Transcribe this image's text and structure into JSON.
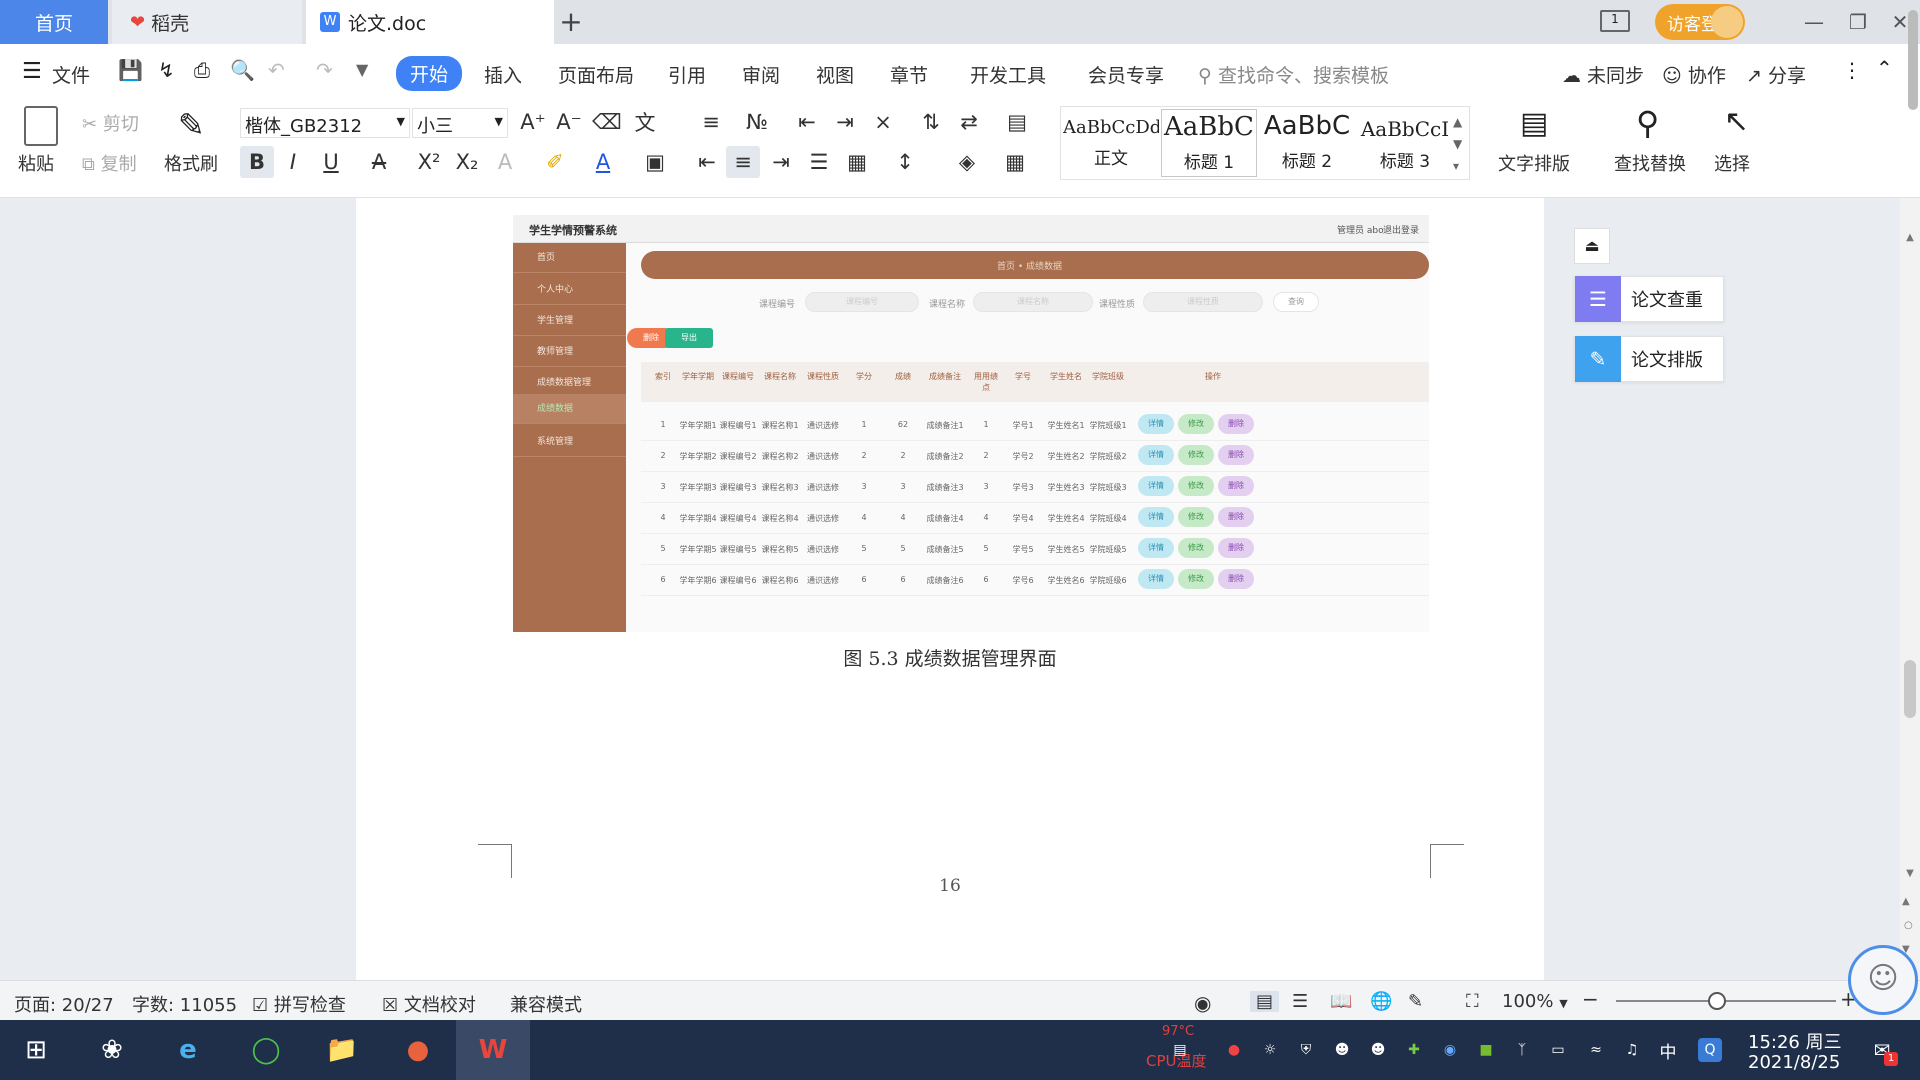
{
  "tabs": {
    "home": "首页",
    "daoke": "稻壳",
    "doc": "论文.doc",
    "new_tab": "+"
  },
  "title_bar": {
    "login": "访客登录"
  },
  "menu": {
    "file": "文件",
    "items": [
      "开始",
      "插入",
      "页面布局",
      "引用",
      "审阅",
      "视图",
      "章节",
      "开发工具",
      "会员专享"
    ],
    "search_placeholder": "查找命令、搜索模板",
    "sync": "未同步",
    "collab": "协作",
    "share": "分享"
  },
  "ribbon": {
    "paste": "粘贴",
    "cut": "剪切",
    "copy": "复制",
    "format_painter": "格式刷",
    "font_name": "楷体_GB2312",
    "font_size": "小三",
    "styles": [
      {
        "preview": "AaBbCcDd",
        "name": "正文"
      },
      {
        "preview": "AaBbC",
        "name": "标题 1"
      },
      {
        "preview": "AaBbC",
        "name": "标题 2"
      },
      {
        "preview": "AaBbCcI",
        "name": "标题 3"
      }
    ],
    "text_layout": "文字排版",
    "find_replace": "查找替换",
    "select": "选择"
  },
  "document": {
    "caption": "图 5.3  成绩数据管理界面",
    "page_number": "16",
    "screenshot": {
      "app_title": "学生学情预警系统",
      "user": "管理员 abo",
      "logout": "退出登录",
      "menu": [
        "首页",
        "个人中心",
        "学生管理",
        "教师管理",
        "成绩数据管理",
        "成绩数据",
        "系统管理"
      ],
      "breadcrumb": "首页 • 成绩数据",
      "filters": [
        "课程编号",
        "课程名称",
        "课程性质"
      ],
      "filter_placeholders": [
        "课程编号",
        "课程名称",
        "课程性质"
      ],
      "search_btn": "查询",
      "delete_btn": "删除",
      "export_btn": "导出",
      "columns": [
        "索引",
        "学年学期",
        "课程编号",
        "课程名称",
        "课程性质",
        "学分",
        "成绩",
        "成绩备注",
        "用用绩点",
        "学号",
        "学生姓名",
        "学院班级",
        "操作"
      ],
      "rows": [
        [
          "1",
          "学年学期1",
          "课程编号1",
          "课程名称1",
          "通识选修",
          "1",
          "62",
          "成绩备注1",
          "1",
          "学号1",
          "学生姓名1",
          "学院班级1"
        ],
        [
          "2",
          "学年学期2",
          "课程编号2",
          "课程名称2",
          "通识选修",
          "2",
          "2",
          "成绩备注2",
          "2",
          "学号2",
          "学生姓名2",
          "学院班级2"
        ],
        [
          "3",
          "学年学期3",
          "课程编号3",
          "课程名称3",
          "通识选修",
          "3",
          "3",
          "成绩备注3",
          "3",
          "学号3",
          "学生姓名3",
          "学院班级3"
        ],
        [
          "4",
          "学年学期4",
          "课程编号4",
          "课程名称4",
          "通识选修",
          "4",
          "4",
          "成绩备注4",
          "4",
          "学号4",
          "学生姓名4",
          "学院班级4"
        ],
        [
          "5",
          "学年学期5",
          "课程编号5",
          "课程名称5",
          "通识选修",
          "5",
          "5",
          "成绩备注5",
          "5",
          "学号5",
          "学生姓名5",
          "学院班级5"
        ],
        [
          "6",
          "学年学期6",
          "课程编号6",
          "课程名称6",
          "通识选修",
          "6",
          "6",
          "成绩备注6",
          "6",
          "学号6",
          "学生姓名6",
          "学院班级6"
        ]
      ],
      "row_actions": [
        "详情",
        "修改",
        "删除"
      ]
    }
  },
  "side_panel": {
    "check": "论文查重",
    "layout": "论文排版"
  },
  "status": {
    "page": "页面: 20/27",
    "words": "字数: 11055",
    "spell": "拼写检查",
    "proof": "文档校对",
    "compat": "兼容模式",
    "zoom": "100%"
  },
  "taskbar": {
    "time": "15:26 周三",
    "date": "2021/8/25",
    "cpu_temp": "97°C",
    "cpu_label": "CPU温度",
    "ime": "中",
    "notification_count": "1"
  },
  "colors": {
    "accent": "#3f82f5",
    "home_tab": "#4b86e8",
    "login": "#f0a32b",
    "sidebar_brown": "#a86e4d",
    "taskbar": "#1f2f49"
  }
}
